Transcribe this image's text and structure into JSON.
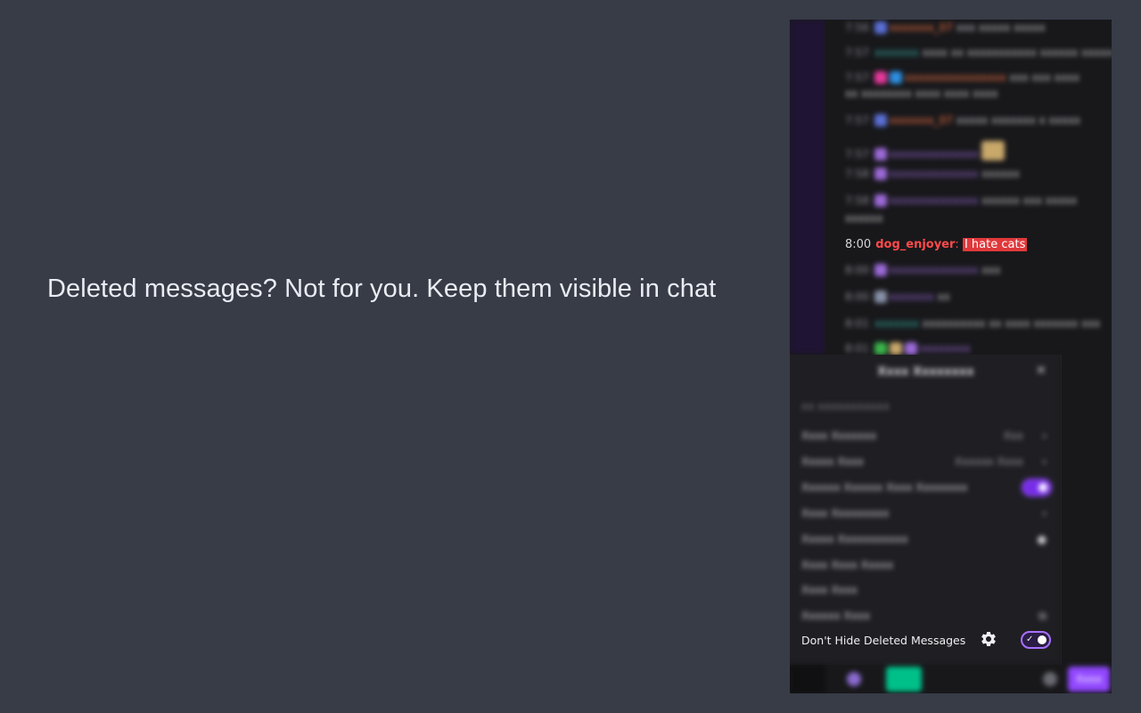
{
  "headline": "Deleted messages? Not for you. Keep them visible in chat",
  "chat": {
    "deleted_message": {
      "time": "8:00",
      "username": "dog_enjoyer",
      "separator": ":",
      "text": "I hate cats"
    }
  },
  "settings": {
    "feature_row": {
      "label": "Don't Hide Deleted Messages",
      "toggle_on": true
    }
  },
  "colors": {
    "background": "#373c47",
    "username": "#ff4b4b",
    "deleted_highlight": "#e0383b",
    "toggle_accent": "#a970ff"
  }
}
